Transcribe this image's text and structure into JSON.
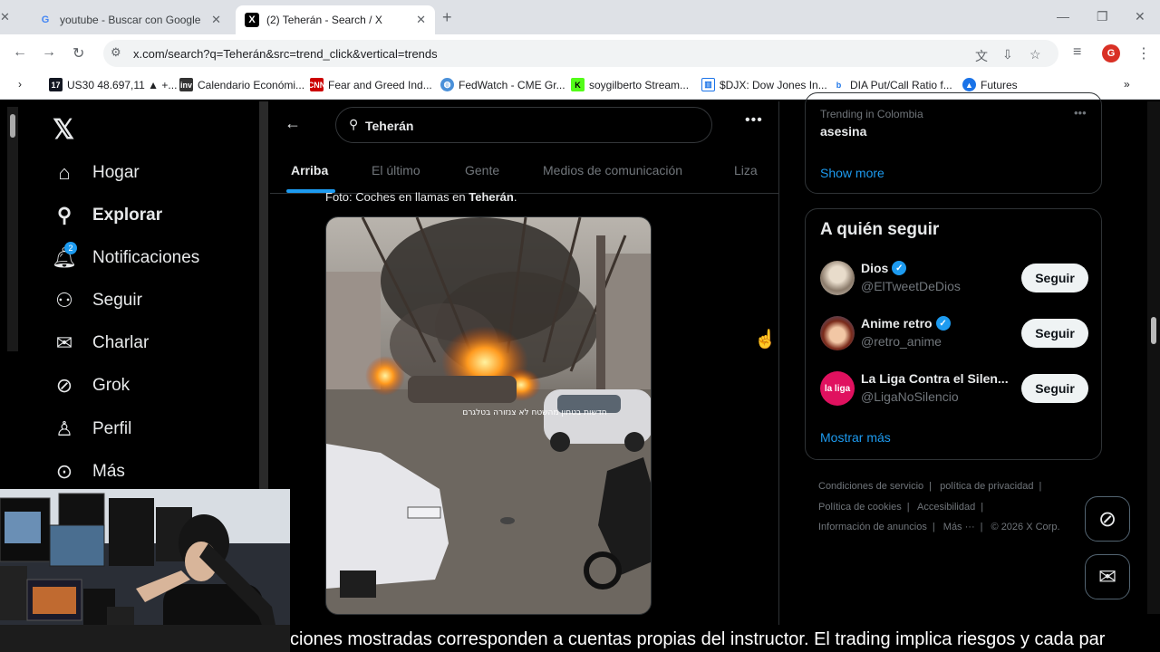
{
  "browser": {
    "tabs": [
      {
        "title": "youtube - Buscar con Google",
        "favicon": "G"
      },
      {
        "title": "(2) Teherán - Search / X",
        "favicon": "X"
      }
    ],
    "url": "x.com/search?q=Teherán&src=trend_click&vertical=trends",
    "profile_initial": "G",
    "bookmarks": [
      {
        "label": "US30 48.697,11 ▲ +...",
        "icon": "17"
      },
      {
        "label": "Calendario Económi...",
        "icon": "inv"
      },
      {
        "label": "Fear and Greed Ind...",
        "icon": "CNN"
      },
      {
        "label": "FedWatch - CME Gr...",
        "icon": "globe"
      },
      {
        "label": "soygilberto Stream...",
        "icon": "K"
      },
      {
        "label": "$DJX: Dow Jones In...",
        "icon": "chart"
      },
      {
        "label": "DIA Put/Call Ratio f...",
        "icon": "b"
      },
      {
        "label": "Futures",
        "icon": "chart-blue"
      }
    ]
  },
  "sidenav": {
    "items": [
      {
        "label": "Hogar",
        "icon": "home-icon"
      },
      {
        "label": "Explorar",
        "icon": "search-icon"
      },
      {
        "label": "Notificaciones",
        "icon": "bell-icon",
        "badge": "2"
      },
      {
        "label": "Seguir",
        "icon": "add-person-icon"
      },
      {
        "label": "Charlar",
        "icon": "mail-icon"
      },
      {
        "label": "Grok",
        "icon": "grok-icon"
      },
      {
        "label": "Perfil",
        "icon": "person-icon"
      },
      {
        "label": "Más",
        "icon": "more-circle-icon"
      }
    ]
  },
  "search": {
    "query": "Teherán",
    "tabs": [
      "Arriba",
      "El último",
      "Gente",
      "Medios de comunicación",
      "Liza"
    ],
    "active_tab": "Arriba"
  },
  "post": {
    "caption_prefix": "Foto: Coches en llamas en ",
    "caption_bold": "Teherán",
    "caption_suffix": ".",
    "image_watermark": "חדשות בטחון מהשטח לא צנזורה בטלגרם"
  },
  "trending": {
    "meta": "Trending in Colombia",
    "name": "asesina",
    "show_more": "Show more"
  },
  "who_to_follow": {
    "title": "A quién seguir",
    "accounts": [
      {
        "name": "Dios",
        "handle": "@ElTweetDeDios",
        "verified": true,
        "follow": "Seguir"
      },
      {
        "name": "Anime retro",
        "handle": "@retro_anime",
        "verified": true,
        "follow": "Seguir"
      },
      {
        "name": "La Liga Contra el Silen...",
        "handle": "@LigaNoSilencio",
        "verified": false,
        "follow": "Seguir"
      }
    ],
    "more": "Mostrar más"
  },
  "footer": {
    "links": [
      "Condiciones de servicio",
      "política de privacidad",
      "Política de cookies",
      "Accesibilidad",
      "Información de anuncios",
      "Más ···",
      "© 2026 X Corp."
    ]
  },
  "ticker": {
    "text": "ciones mostradas corresponden a cuentas propias del instructor. El trading implica riesgos y cada par"
  },
  "colors": {
    "accent": "#1d9bf0",
    "background": "#000000",
    "text": "#e7e9ea",
    "muted": "#71767b"
  }
}
